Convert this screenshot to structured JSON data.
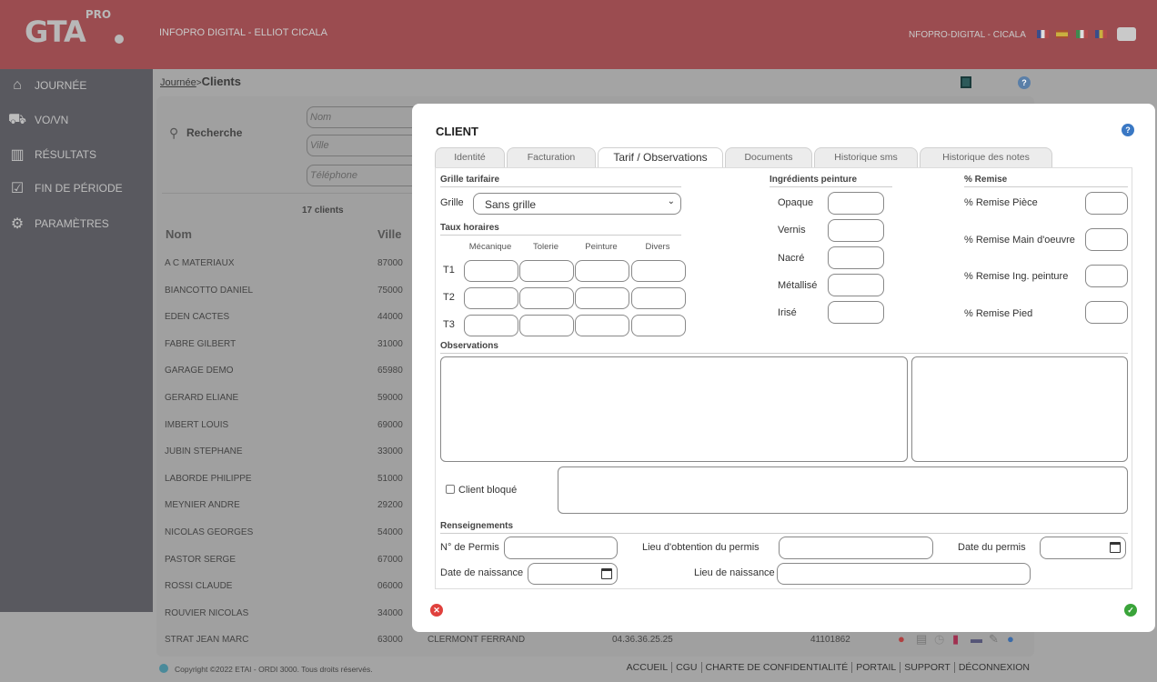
{
  "header": {
    "logo": "GTA",
    "logo_sup": "PRO",
    "title": "INFOPRO DIGITAL - ELLIOT CICALA",
    "user": "NFOPRO-DIGITAL - CICALA",
    "flags": [
      "fr",
      "es",
      "it",
      "ro"
    ]
  },
  "sidebar": {
    "items": [
      {
        "label": "JOURNÉE",
        "icon": "home-icon",
        "glyph": "⌂"
      },
      {
        "label": "VO/VN",
        "icon": "car-icon",
        "glyph": "⛟"
      },
      {
        "label": "RÉSULTATS",
        "icon": "bar-chart-icon",
        "glyph": "▥"
      },
      {
        "label": "FIN DE PÉRIODE",
        "icon": "calendar-check-icon",
        "glyph": "☑"
      },
      {
        "label": "PARAMÈTRES",
        "icon": "gear-icon",
        "glyph": "⚙"
      }
    ]
  },
  "breadcrumb": {
    "parent": "Journée",
    "sep": ">",
    "current": "Clients"
  },
  "search": {
    "label": "Recherche",
    "nom_placeholder": "Nom",
    "ville_placeholder": "Ville",
    "tel_placeholder": "Téléphone",
    "count": "17 clients"
  },
  "list": {
    "col_nom": "Nom",
    "col_ville": "Ville",
    "rows": [
      {
        "nom": "A C MATERIAUX",
        "cp": "87000"
      },
      {
        "nom": "BIANCOTTO DANIEL",
        "cp": "75000"
      },
      {
        "nom": "EDEN CACTES",
        "cp": "44000"
      },
      {
        "nom": "FABRE GILBERT",
        "cp": "31000"
      },
      {
        "nom": "GARAGE DEMO",
        "cp": "65980"
      },
      {
        "nom": "GERARD ELIANE",
        "cp": "59000"
      },
      {
        "nom": "IMBERT LOUIS",
        "cp": "69000"
      },
      {
        "nom": "JUBIN STEPHANE",
        "cp": "33000"
      },
      {
        "nom": "LABORDE PHILIPPE",
        "cp": "51000"
      },
      {
        "nom": "MEYNIER ANDRE",
        "cp": "29200"
      },
      {
        "nom": "NICOLAS GEORGES",
        "cp": "54000"
      },
      {
        "nom": "PASTOR SERGE",
        "cp": "67000"
      },
      {
        "nom": "ROSSI CLAUDE",
        "cp": "06000"
      },
      {
        "nom": "ROUVIER NICOLAS",
        "cp": "34000"
      },
      {
        "nom": "STRAT JEAN MARC",
        "cp": "63000",
        "ville": "CLERMONT FERRAND",
        "tel": "04.36.36.25.25",
        "code": "41101862"
      }
    ]
  },
  "footer": {
    "copyright": "Copyright ©2022 ETAI - ORDI 3000. Tous droits réservés.",
    "links": [
      "ACCUEIL",
      "CGU",
      "CHARTE DE CONFIDENTIALITÉ",
      "PORTAIL",
      "SUPPORT",
      "DÉCONNEXION"
    ]
  },
  "modal": {
    "title": "CLIENT",
    "tabs": [
      "Identité",
      "Facturation",
      "Tarif / Observations",
      "Documents",
      "Historique sms",
      "Historique des notes"
    ],
    "active_tab": "Tarif / Observations",
    "grille_section": "Grille tarifaire",
    "grille_label": "Grille",
    "grille_value": "Sans grille",
    "taux_section": "Taux horaires",
    "taux_cols": [
      "Mécanique",
      "Tolerie",
      "Peinture",
      "Divers"
    ],
    "taux_rows": [
      "T1",
      "T2",
      "T3"
    ],
    "ingredients_section": "Ingrédients peinture",
    "ingredients": [
      "Opaque",
      "Vernis",
      "Nacré",
      "Métallisé",
      "Irisé"
    ],
    "remise_section": "% Remise",
    "remises": [
      "% Remise Pièce",
      "% Remise Main d'oeuvre",
      "% Remise Ing. peinture",
      "% Remise Pied"
    ],
    "observations_section": "Observations",
    "client_bloque": "Client bloqué",
    "renseignements_section": "Renseignements",
    "permis_no": "N° de Permis",
    "permis_lieu": "Lieu d'obtention du permis",
    "permis_date": "Date du permis",
    "naissance_date": "Date de naissance",
    "naissance_lieu": "Lieu de naissance"
  },
  "colors": {
    "header": "#9b4c50",
    "sidebar": "#59595f",
    "cancel": "#e0413d",
    "ok": "#3aa43a",
    "help": "#3a78c4"
  }
}
